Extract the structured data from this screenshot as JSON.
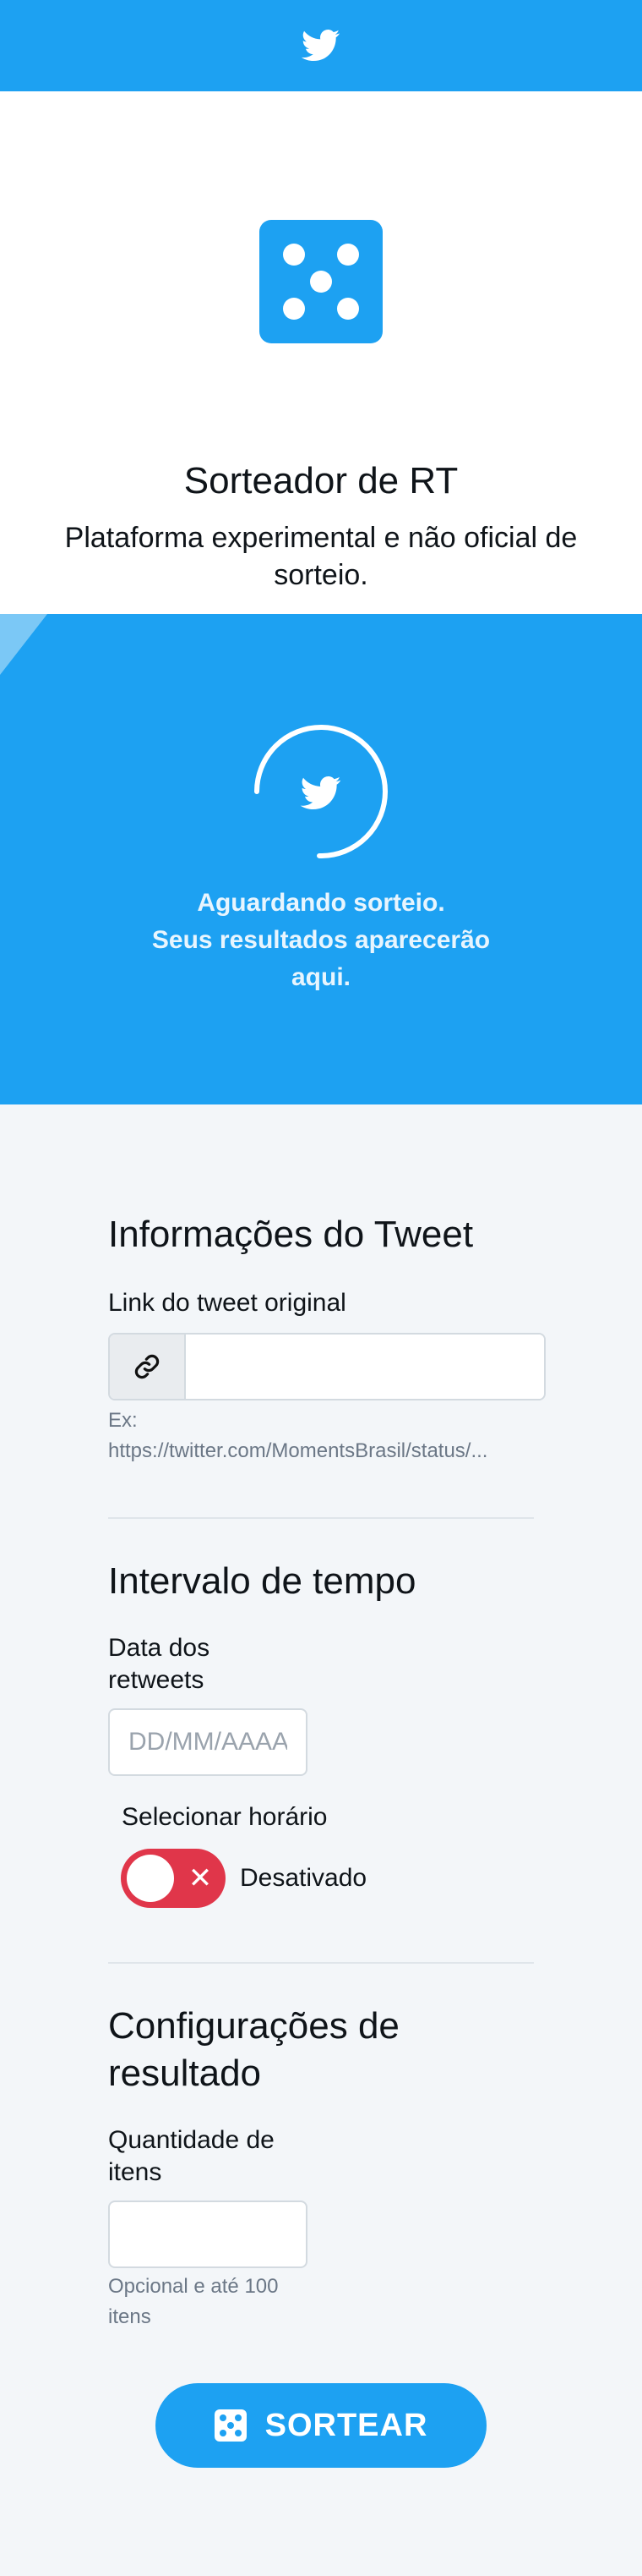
{
  "header": {
    "logo_icon": "twitter-bird-icon",
    "color": "#1da1f2"
  },
  "hero": {
    "icon": "dice-five-icon",
    "title": "Sorteador de RT",
    "subtitle": "Plataforma experimental e não oficial de sorteio."
  },
  "result": {
    "icon": "twitter-bird-icon",
    "line1": "Aguardando sorteio.",
    "line2": "Seus resultados aparecerão",
    "line3": "aqui."
  },
  "tweet_info": {
    "title": "Informações do Tweet",
    "link_label": "Link do tweet original",
    "link_icon": "link-icon",
    "link_value": "",
    "hint_line1": "Ex:",
    "hint_line2": "https://twitter.com/MomentsBrasil/status/..."
  },
  "time_interval": {
    "title": "Intervalo de tempo",
    "date_label_line1": "Data dos",
    "date_label_line2": "retweets",
    "date_placeholder": "DD/MM/AAAA",
    "time_label": "Selecionar horário",
    "toggle_state": "Desativado",
    "toggle_on": false
  },
  "result_config": {
    "title_line1": "Configurações de",
    "title_line2": "resultado",
    "qty_label_line1": "Quantidade de",
    "qty_label_line2": "itens",
    "qty_value": "",
    "hint_line1": "Opcional e até 100",
    "hint_line2": "itens"
  },
  "submit": {
    "label": "SORTEAR",
    "icon": "dice-five-icon"
  },
  "colors": {
    "accent": "#1da1f2",
    "danger": "#e0364a",
    "background": "#f3f6f9"
  }
}
